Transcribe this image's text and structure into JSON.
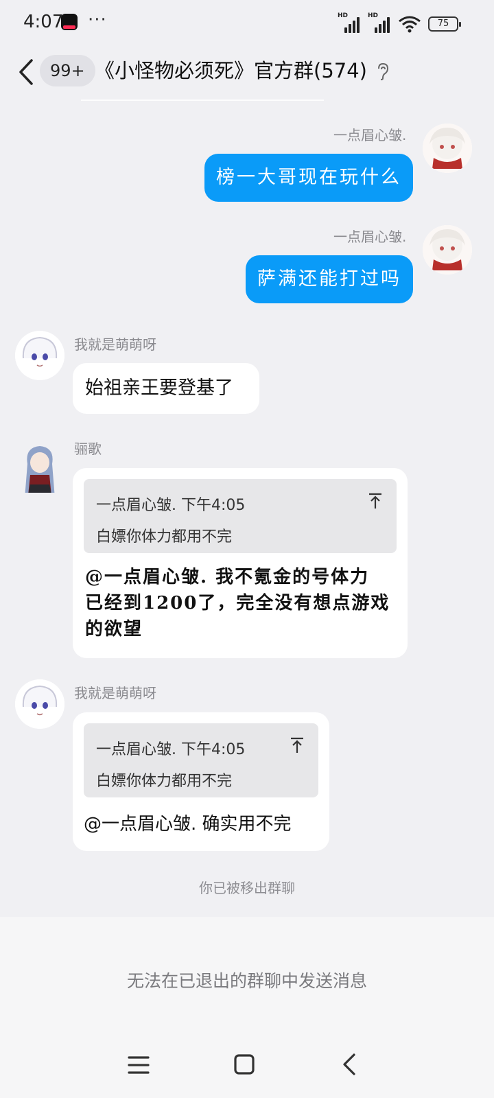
{
  "status_bar": {
    "time": "4:07",
    "more": "···",
    "signal_label_1": "HD",
    "signal_label_2": "HD",
    "battery": "75"
  },
  "header": {
    "unread_badge": "99+",
    "title": "《小怪物必须死》官方群(574)"
  },
  "messages": [
    {
      "sender": "一点眉心皱.",
      "text": "榜一大哥现在玩什么",
      "side": "right"
    },
    {
      "sender": "一点眉心皱.",
      "text": "萨满还能打过吗",
      "side": "right"
    },
    {
      "sender": "我就是萌萌呀",
      "text": "始祖亲王要登基了",
      "side": "left"
    },
    {
      "sender": "骊歌",
      "side": "left",
      "quote_author": "一点眉心皱. 下午4:05",
      "quote_text": "白嫖你体力都用不完",
      "lines": [
        "@一点眉心皱. 我不氪金的号体力",
        "已经到1200了，完全没有想点游戏",
        "的欲望"
      ]
    },
    {
      "sender": "我就是萌萌呀",
      "side": "left",
      "quote_author": "一点眉心皱. 下午4:05",
      "quote_text": "白嫖你体力都用不完",
      "text": "@一点眉心皱. 确实用不完"
    }
  ],
  "notice": "你已被移出群聊",
  "input_area": {
    "message": "无法在已退出的群聊中发送消息"
  },
  "colors": {
    "background": "#f0f0f3",
    "my_bubble": "#0a9bf8",
    "other_bubble": "#ffffff",
    "quote_bg": "#e7e7e9"
  }
}
